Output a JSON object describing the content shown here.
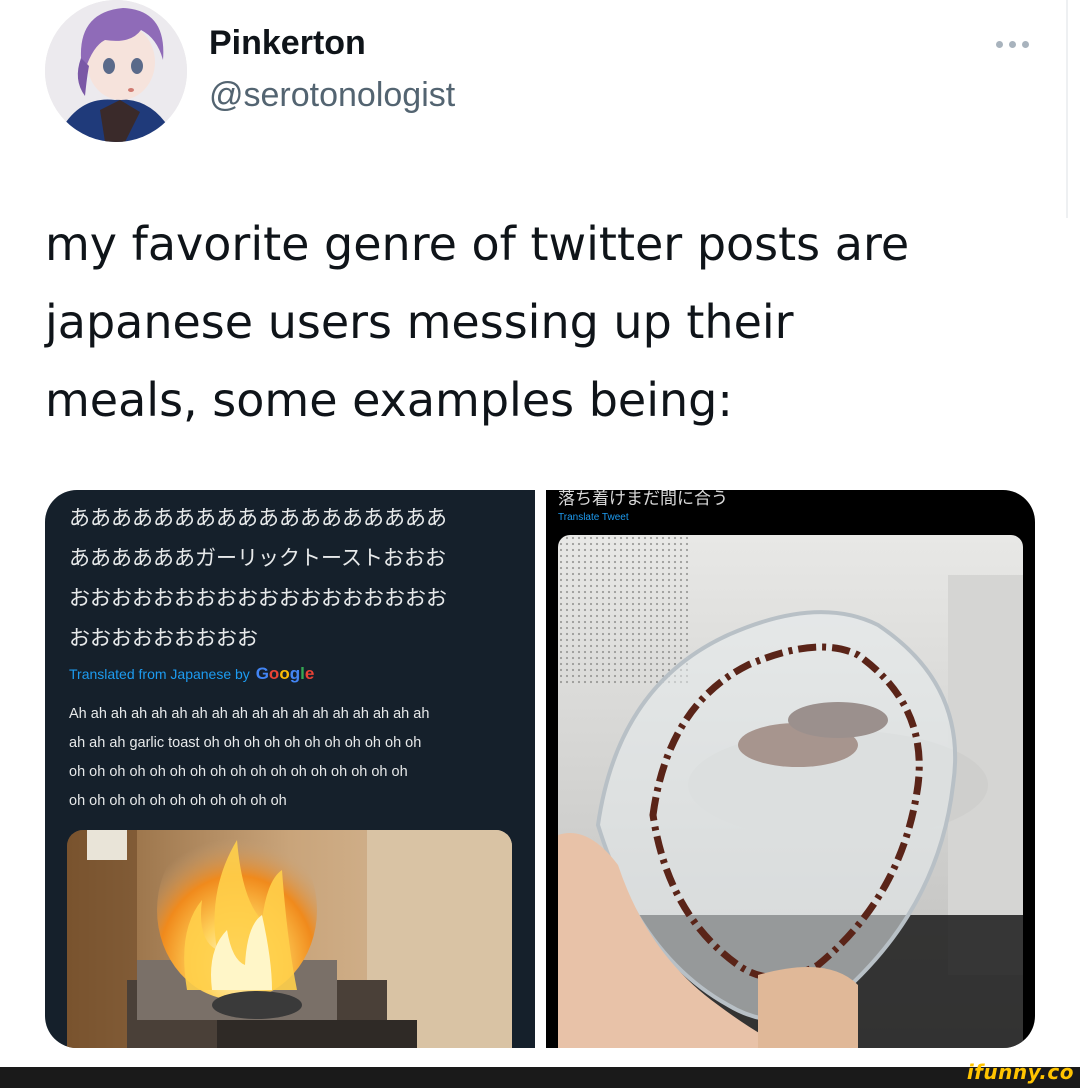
{
  "tweet": {
    "display_name": "Pinkerton",
    "handle": "@serotonologist",
    "more_icon": "more-horizontal-icon",
    "text_lines": [
      "my favorite genre of twitter posts are",
      "japanese users messing up their",
      "meals, some examples being:"
    ]
  },
  "embedded_left": {
    "japanese_lines": [
      "ああああああああああああああああああ",
      "ああああああガーリックトーストおおお",
      "おおおおおおおおおおおおおおおおおお",
      "おおおおおおおおお"
    ],
    "translated_label": "Translated from Japanese by",
    "translator_brand": "Google",
    "translation_lines": [
      "Ah ah ah ah ah ah ah ah ah ah ah ah ah ah ah ah ah ah",
      "ah ah ah garlic toast oh oh oh oh oh oh oh oh oh oh oh",
      "oh oh oh oh oh oh oh oh oh oh oh oh oh oh oh oh oh",
      "oh oh oh oh oh oh oh oh oh oh oh"
    ],
    "photo": "toaster-on-fire-photo"
  },
  "embedded_right": {
    "japanese_cut_text": "落ち着けまだ間に合う",
    "translate_link": "Translate Tweet",
    "photo": "melted-plastic-container-microwave-photo"
  },
  "watermark": "ifunny.co",
  "colors": {
    "link_blue": "#1d9bf0",
    "dark_panel": "#15202b",
    "watermark_yellow": "#ffc400"
  }
}
